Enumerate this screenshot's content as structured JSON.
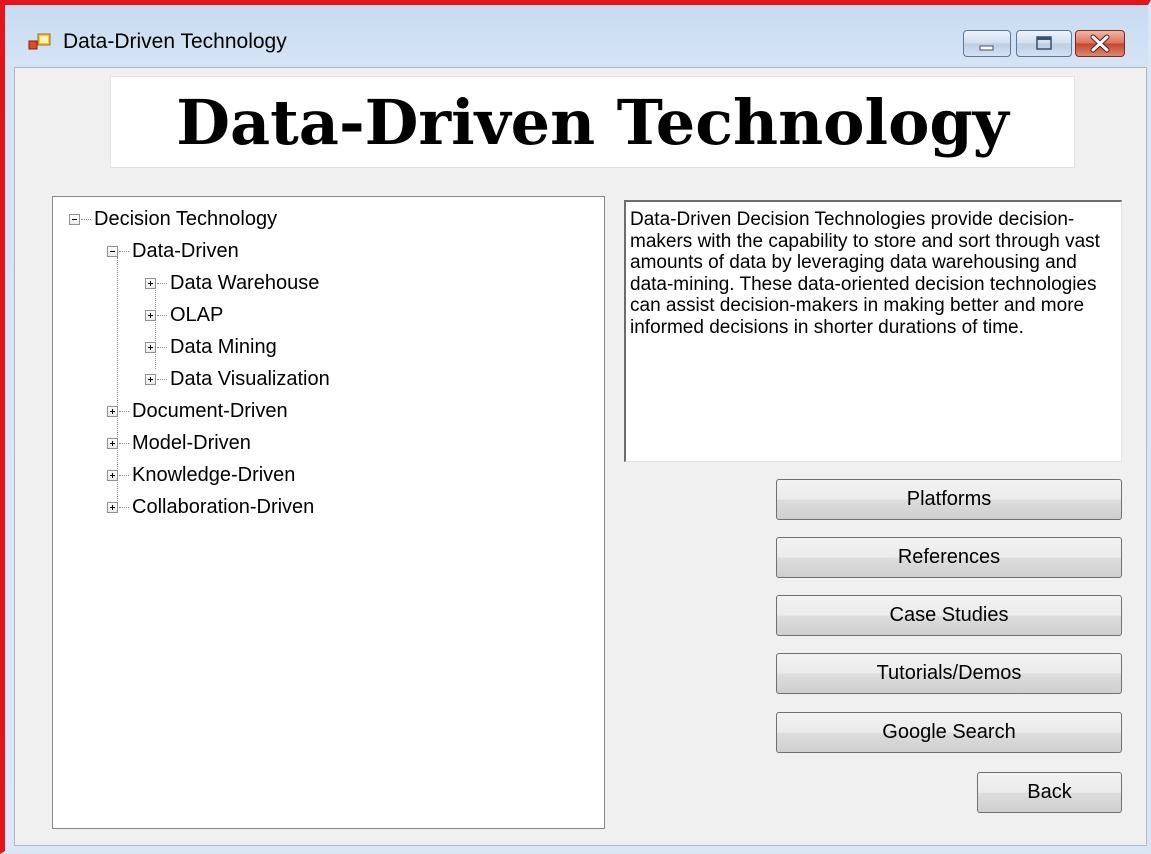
{
  "window": {
    "title": "Data-Driven Technology"
  },
  "banner": {
    "heading": "Data-Driven Technology"
  },
  "tree": {
    "root": "Decision Technology",
    "data_driven": {
      "label": "Data-Driven",
      "children": [
        "Data Warehouse",
        "OLAP",
        "Data Mining",
        "Data Visualization"
      ]
    },
    "siblings": [
      "Document-Driven",
      "Model-Driven",
      "Knowledge-Driven",
      "Collaboration-Driven"
    ]
  },
  "description": "Data-Driven Decision Technologies provide decision-makers with the capability to store and sort through vast amounts of data by leveraging data warehousing and data-mining. These data-oriented decision technologies can assist decision-makers in making better and more informed decisions in shorter durations of time.",
  "buttons": {
    "platforms": "Platforms",
    "references": "References",
    "case_studies": "Case Studies",
    "tutorials": "Tutorials/Demos",
    "google_search": "Google Search",
    "back": "Back"
  }
}
